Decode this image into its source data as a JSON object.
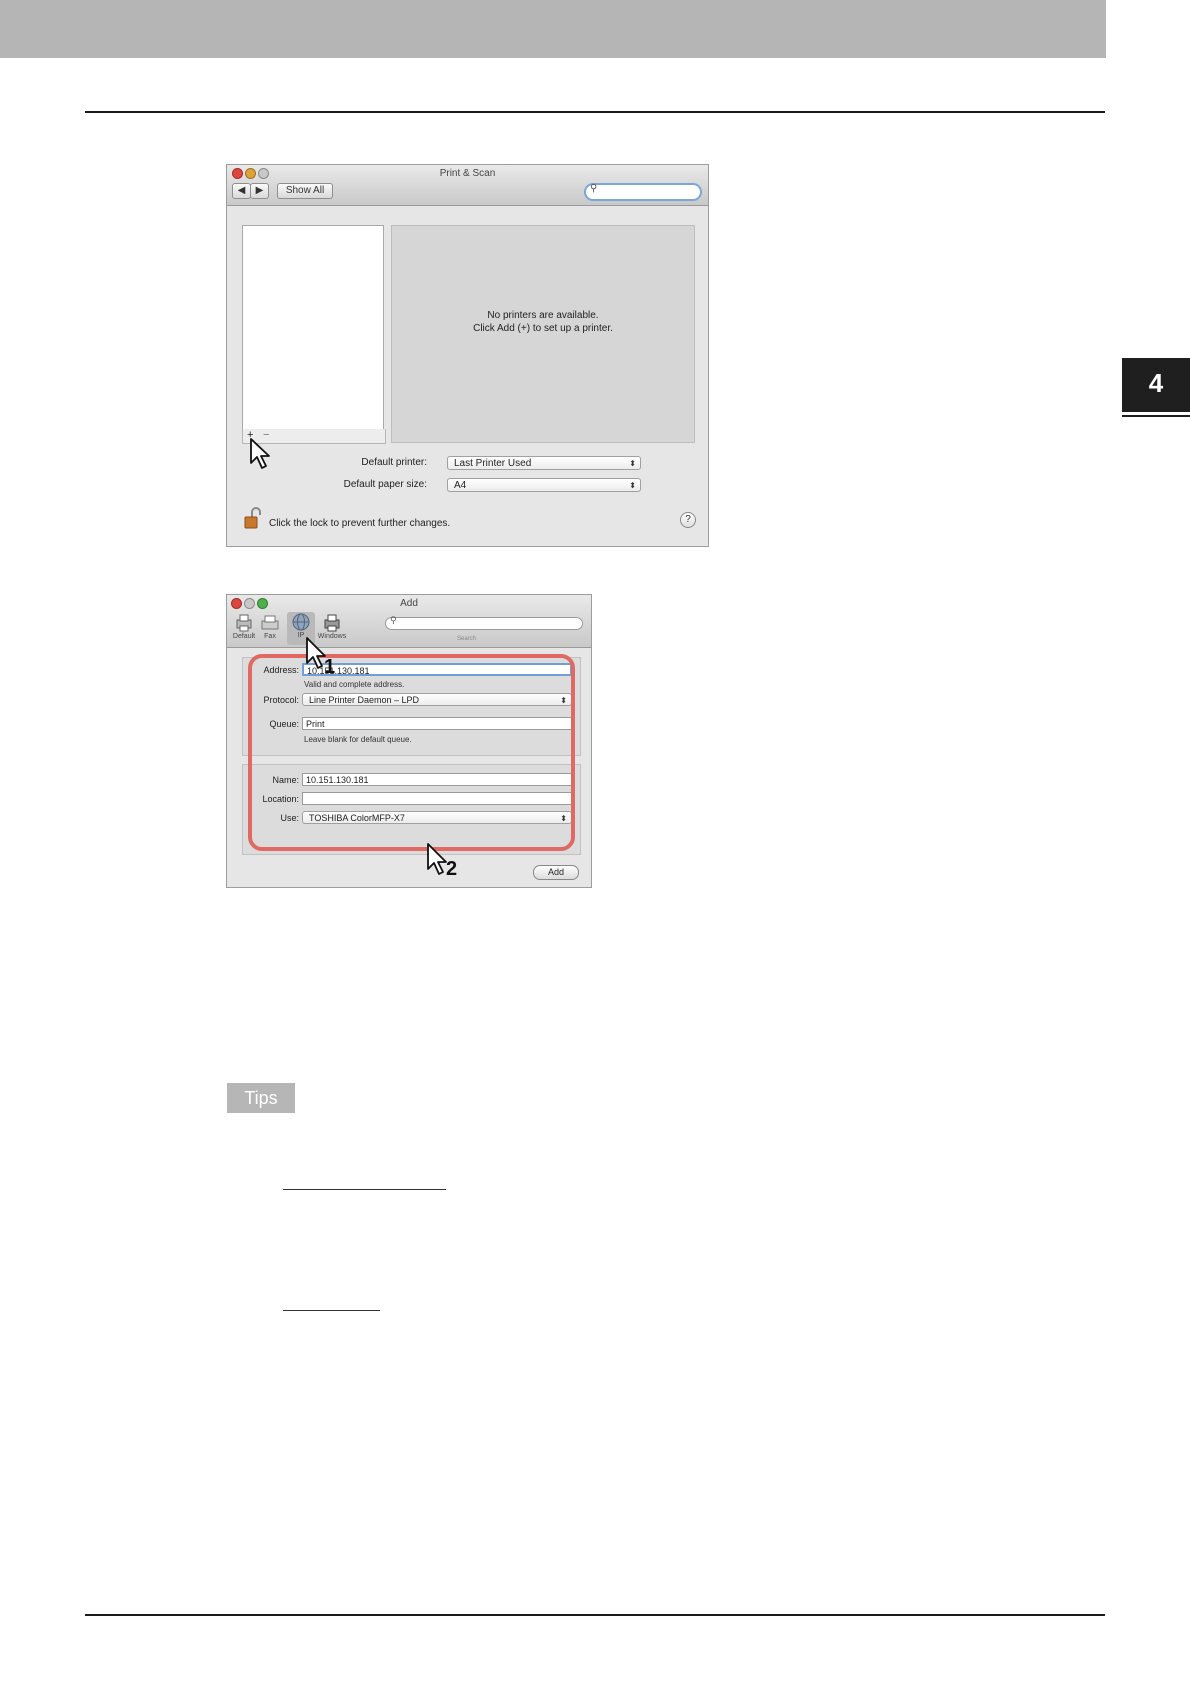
{
  "chapter_number": "4",
  "print_scan": {
    "title": "Print & Scan",
    "show_all_label": "Show All",
    "back_label": "◀",
    "forward_label": "▶",
    "search_value": "",
    "message_line1": "No printers are available.",
    "message_line2": "Click Add (+) to set up a printer.",
    "add_label": "+",
    "remove_label": "−",
    "default_printer_label": "Default printer:",
    "default_printer_value": "Last Printer Used",
    "default_paper_label": "Default paper size:",
    "default_paper_value": "A4",
    "lock_text": "Click the lock to prevent further changes.",
    "help_label": "?"
  },
  "add_window": {
    "title": "Add",
    "toolbar": [
      "Default",
      "Fax",
      "IP",
      "Windows"
    ],
    "search_caption": "Search",
    "address_label": "Address:",
    "address_value": "10.151.130.181",
    "address_note": "Valid and complete address.",
    "protocol_label": "Protocol:",
    "protocol_value": "Line Printer Daemon – LPD",
    "queue_label": "Queue:",
    "queue_value": "Print",
    "queue_note": "Leave blank for default queue.",
    "name_label": "Name:",
    "name_value": "10.151.130.181",
    "location_label": "Location:",
    "location_value": "",
    "use_label": "Use:",
    "use_value": "TOSHIBA ColorMFP-X7",
    "add_button": "Add"
  },
  "step_markers": [
    "1",
    "2"
  ],
  "tips_label": "Tips",
  "colors": {
    "highlight": "#e06a63",
    "band": "#b5b5b5",
    "tab": "#1f1f1f"
  }
}
